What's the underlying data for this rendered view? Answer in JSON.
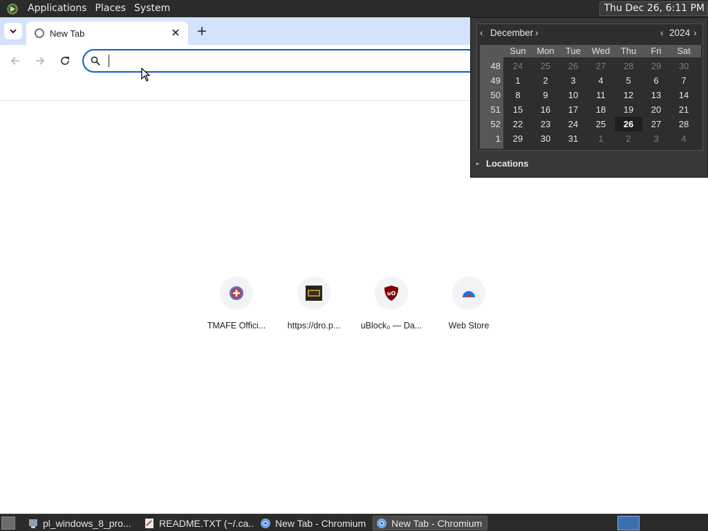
{
  "top_panel": {
    "menus": [
      "Applications",
      "Places",
      "System"
    ],
    "clock": "Thu Dec 26,  6:11 PM"
  },
  "browser": {
    "tab_title": "New Tab",
    "omnibox": {
      "value": "",
      "placeholder": ""
    },
    "shortcuts": [
      {
        "label": "TMAFE Offici...",
        "icon": "tmafe-icon"
      },
      {
        "label": "https://dro.p...",
        "icon": "dro-site-icon"
      },
      {
        "label": "uBlock₀ — Da...",
        "icon": "ublock-origin-icon"
      },
      {
        "label": "Web Store",
        "icon": "chrome-web-store-icon"
      }
    ]
  },
  "calendar": {
    "month": "December",
    "year": "2024",
    "day_names": [
      "Sun",
      "Mon",
      "Tue",
      "Wed",
      "Thu",
      "Fri",
      "Sat"
    ],
    "weeks": [
      {
        "week": "48",
        "days": [
          "24",
          "25",
          "26",
          "27",
          "28",
          "29",
          "30"
        ],
        "other": [
          true,
          true,
          true,
          true,
          true,
          true,
          true
        ]
      },
      {
        "week": "49",
        "days": [
          "1",
          "2",
          "3",
          "4",
          "5",
          "6",
          "7"
        ],
        "other": [
          false,
          false,
          false,
          false,
          false,
          false,
          false
        ]
      },
      {
        "week": "50",
        "days": [
          "8",
          "9",
          "10",
          "11",
          "12",
          "13",
          "14"
        ],
        "other": [
          false,
          false,
          false,
          false,
          false,
          false,
          false
        ]
      },
      {
        "week": "51",
        "days": [
          "15",
          "16",
          "17",
          "18",
          "19",
          "20",
          "21"
        ],
        "other": [
          false,
          false,
          false,
          false,
          false,
          false,
          false
        ]
      },
      {
        "week": "52",
        "days": [
          "22",
          "23",
          "24",
          "25",
          "26",
          "27",
          "28"
        ],
        "other": [
          false,
          false,
          false,
          false,
          false,
          false,
          false
        ]
      },
      {
        "week": "1",
        "days": [
          "29",
          "30",
          "31",
          "1",
          "2",
          "3",
          "4"
        ],
        "other": [
          false,
          false,
          false,
          true,
          true,
          true,
          true
        ]
      }
    ],
    "today": "26",
    "locations_label": "Locations"
  },
  "taskbar": {
    "items": [
      {
        "label": "pl_windows_8_pro...",
        "icon": "network-file-icon",
        "active": false
      },
      {
        "label": "README.TXT (~/.ca...",
        "icon": "text-editor-icon",
        "active": false
      },
      {
        "label": "New Tab - Chromium",
        "icon": "chromium-icon",
        "active": false
      },
      {
        "label": "New Tab - Chromium",
        "icon": "chromium-icon",
        "active": true
      }
    ]
  },
  "colors": {
    "panel_bg": "#2b2b2b",
    "tab_strip_bg": "#d3e3fd",
    "omnibox_border": "#0b57d0",
    "calendar_bg": "#383838"
  }
}
